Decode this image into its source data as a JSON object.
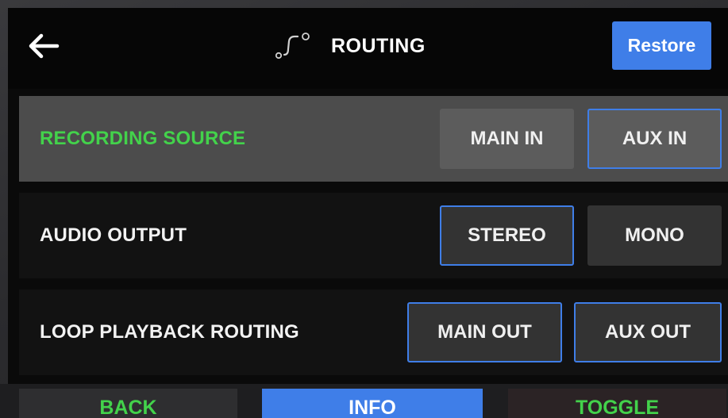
{
  "header": {
    "back_icon": "arrow-left-icon",
    "routing_icon": "routing-icon",
    "title": "ROUTING",
    "restore_label": "Restore",
    "accent_color": "#3f7ee8"
  },
  "rows": [
    {
      "label": "RECORDING SOURCE",
      "selected": true,
      "options": [
        "MAIN IN",
        "AUX IN"
      ],
      "active_option": "AUX IN"
    },
    {
      "label": "AUDIO OUTPUT",
      "selected": false,
      "options": [
        "STEREO",
        "MONO"
      ],
      "active_option": "STEREO"
    },
    {
      "label": "LOOP PLAYBACK ROUTING",
      "selected": false,
      "options": [
        "MAIN OUT",
        "AUX OUT"
      ],
      "active_option": "MAIN OUT"
    }
  ],
  "softkeys": [
    {
      "label": "BACK",
      "color": "#43d24b"
    },
    {
      "label": "INFO",
      "color": "#ffffff"
    },
    {
      "label": "TOGGLE",
      "color": "#43d24b"
    }
  ],
  "colors": {
    "selected_label": "#43d24b",
    "active_border": "#3f7ee8",
    "info_key_bg": "#3f7ee8"
  }
}
